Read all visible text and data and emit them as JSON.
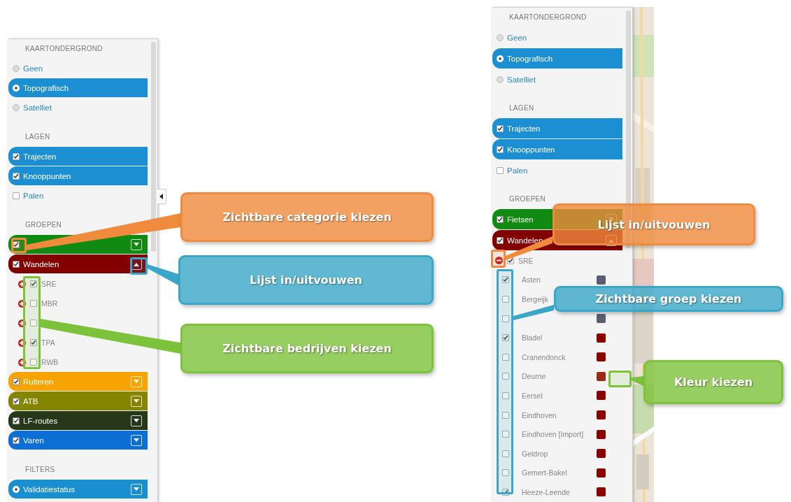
{
  "left_panel": {
    "sections": [
      {
        "title": "KAARTONDERGROND",
        "items": [
          {
            "kind": "radio",
            "label": "Geen",
            "selected": false
          },
          {
            "kind": "radio",
            "label": "Topografisch",
            "selected": true
          },
          {
            "kind": "radio",
            "label": "Satelliet",
            "selected": false
          }
        ]
      },
      {
        "title": "LAGEN",
        "items": [
          {
            "kind": "layer",
            "label": "Trajecten",
            "checked": true
          },
          {
            "kind": "layer",
            "label": "Knooppunten",
            "checked": true
          },
          {
            "kind": "layer",
            "label": "Palen",
            "checked": false
          }
        ]
      },
      {
        "title": "GROEPEN",
        "items": [
          {
            "kind": "group",
            "checked": true,
            "color": "#118a11",
            "expanded": false
          },
          {
            "kind": "group",
            "label": "Wandelen",
            "checked": true,
            "color": "#820000",
            "expanded": true,
            "children": [
              {
                "kind": "subgroup",
                "label": "SRE",
                "checked": true,
                "expanded": false
              },
              {
                "kind": "subgroup",
                "label": "MBR",
                "checked": false,
                "expanded": false
              },
              {
                "kind": "subgroup",
                "checked": false,
                "expanded": false
              },
              {
                "kind": "subgroup",
                "label": "TPA",
                "checked": true,
                "expanded": false
              },
              {
                "kind": "subgroup",
                "label": "RWB",
                "checked": false,
                "expanded": false
              }
            ]
          },
          {
            "kind": "group",
            "label": "Ruiteren",
            "checked": true,
            "color": "#f7a400",
            "expanded": false
          },
          {
            "kind": "group",
            "label": "ATB",
            "checked": true,
            "color": "#858500",
            "expanded": false
          },
          {
            "kind": "group",
            "label": "LF-routes",
            "checked": true,
            "color": "#27381a",
            "expanded": false
          },
          {
            "kind": "group",
            "label": "Varen",
            "checked": true,
            "color": "#0d6fd6",
            "expanded": false
          }
        ]
      },
      {
        "title": "FILTERS",
        "items": [
          {
            "kind": "filter",
            "label": "Validatiestatus",
            "color": "#1a8fd0",
            "expanded": false
          }
        ]
      }
    ],
    "callouts": [
      {
        "text": "Zichtbare categorie kiezen",
        "color": "#f08a3c"
      },
      {
        "text": "Lijst in/uitvouwen",
        "color": "#3aa6c8"
      },
      {
        "text": "Zichtbare bedrijven kiezen",
        "color": "#7cc23a"
      }
    ]
  },
  "right_panel": {
    "sections": [
      {
        "title": "KAARTONDERGROND",
        "items": [
          {
            "kind": "radio",
            "label": "Geen",
            "selected": false
          },
          {
            "kind": "radio",
            "label": "Topografisch",
            "selected": true
          },
          {
            "kind": "radio",
            "label": "Satelliet",
            "selected": false
          }
        ]
      },
      {
        "title": "LAGEN",
        "items": [
          {
            "kind": "layer",
            "label": "Trajecten",
            "checked": true
          },
          {
            "kind": "layer",
            "label": "Knooppunten",
            "checked": true
          },
          {
            "kind": "layer",
            "label": "Palen",
            "checked": false
          }
        ]
      },
      {
        "title": "GROEPEN",
        "items": [
          {
            "kind": "group",
            "label": "Fietsen",
            "checked": true,
            "color": "#118a11",
            "expanded": false
          },
          {
            "kind": "group",
            "label": "Wandelen",
            "checked": true,
            "color": "#820000",
            "expanded": true,
            "children": [
              {
                "kind": "subgroup",
                "label": "SRE",
                "checked": true,
                "expanded": true,
                "children": [
                  {
                    "kind": "municipality",
                    "label": "Asten",
                    "checked": true,
                    "color": "#5a5f70"
                  },
                  {
                    "kind": "municipality",
                    "label": "Bergeijk",
                    "checked": false
                  },
                  {
                    "kind": "municipality",
                    "checked": false,
                    "color": "#5a5f70"
                  },
                  {
                    "kind": "municipality",
                    "label": "Bladel",
                    "checked": true,
                    "color": "#8b0000"
                  },
                  {
                    "kind": "municipality",
                    "label": "Cranendonck",
                    "checked": false,
                    "color": "#8b0000"
                  },
                  {
                    "kind": "municipality",
                    "label": "Deurne",
                    "checked": false,
                    "color": "#9a2a14"
                  },
                  {
                    "kind": "municipality",
                    "label": "Eersel",
                    "checked": false,
                    "color": "#8b0000"
                  },
                  {
                    "kind": "municipality",
                    "label": "Eindhoven",
                    "checked": false,
                    "color": "#8b0000"
                  },
                  {
                    "kind": "municipality",
                    "label": "Eindhoven [Import]",
                    "checked": false,
                    "color": "#8b0000"
                  },
                  {
                    "kind": "municipality",
                    "label": "Geldrop",
                    "checked": false,
                    "color": "#8b0000"
                  },
                  {
                    "kind": "municipality",
                    "label": "Gemert-Bakel",
                    "checked": false,
                    "color": "#8b0000"
                  },
                  {
                    "kind": "municipality",
                    "label": "Heeze-Leende",
                    "checked": true,
                    "color": "#8b0000"
                  }
                ]
              }
            ]
          }
        ]
      }
    ],
    "callouts": [
      {
        "text": "Lijst in/uitvouwen",
        "color": "#f08a3c"
      },
      {
        "text": "Zichtbare groep kiezen",
        "color": "#3aa6c8"
      },
      {
        "text": "Kleur kiezen",
        "color": "#7cc23a"
      }
    ]
  }
}
